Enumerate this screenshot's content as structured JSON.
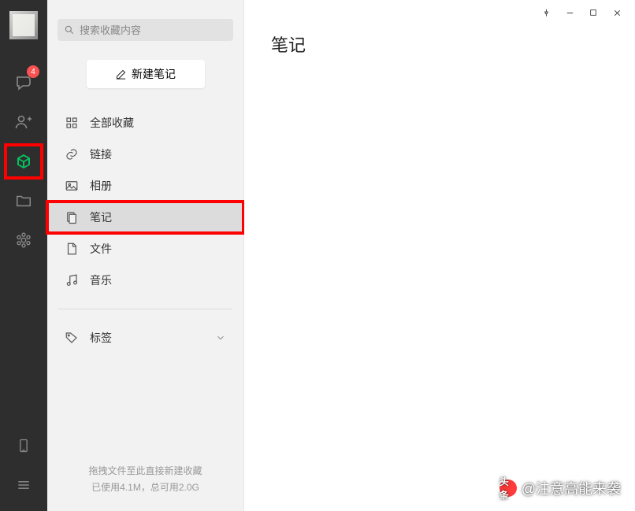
{
  "rail": {
    "chat_badge": "4"
  },
  "search": {
    "placeholder": "搜索收藏内容"
  },
  "new_note_label": "新建笔记",
  "categories": {
    "all": "全部收藏",
    "link": "链接",
    "album": "相册",
    "note": "笔记",
    "file": "文件",
    "music": "音乐"
  },
  "tags_label": "标签",
  "footer": {
    "line1": "拖拽文件至此直接新建收藏",
    "line2": "已使用4.1M，总可用2.0G"
  },
  "main": {
    "title": "笔记"
  },
  "watermark": {
    "logo_text": "头条",
    "handle": "@注意高能来袭"
  }
}
